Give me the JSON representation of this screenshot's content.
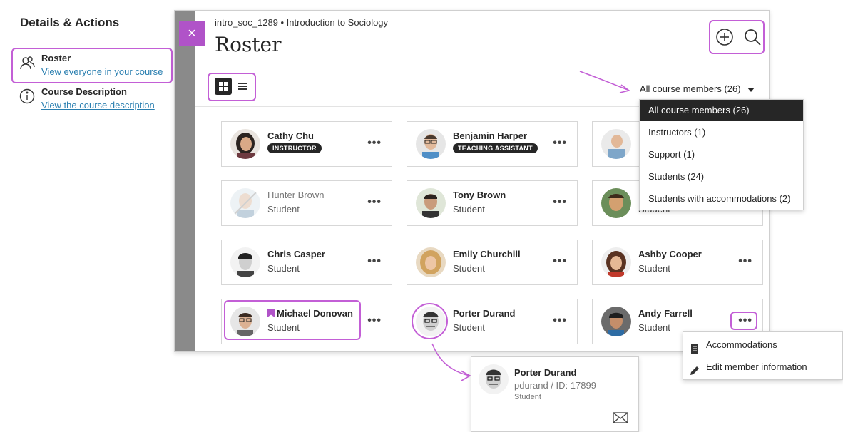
{
  "details_panel": {
    "title": "Details & Actions",
    "items": [
      {
        "name": "Roster",
        "link": "View everyone in your course",
        "icon": "roster-icon"
      },
      {
        "name": "Course Description",
        "link": "View the course description",
        "icon": "info-icon"
      }
    ]
  },
  "roster": {
    "course_breadcrumb": "intro_soc_1289 • Introduction to Sociology",
    "page_title": "Roster",
    "close_label": "×",
    "filter_label": "All course members (26)",
    "filter_options": [
      "All course members (26)",
      "Instructors (1)",
      "Support (1)",
      "Students (24)",
      "Students with accommodations (2)"
    ],
    "more_label": "•••",
    "members": [
      {
        "name": "Cathy Chu",
        "badge": "INSTRUCTOR",
        "role": ""
      },
      {
        "name": "Benjamin Harper",
        "badge": "TEACHING ASSISTANT",
        "role": ""
      },
      {
        "name": "",
        "badge": "",
        "role": ""
      },
      {
        "name": "Hunter Brown",
        "badge": "",
        "role": "Student"
      },
      {
        "name": "Tony Brown",
        "badge": "",
        "role": "Student"
      },
      {
        "name": "",
        "badge": "",
        "role": "Student"
      },
      {
        "name": "Chris Casper",
        "badge": "",
        "role": "Student"
      },
      {
        "name": "Emily Churchill",
        "badge": "",
        "role": "Student"
      },
      {
        "name": "Ashby Cooper",
        "badge": "",
        "role": "Student"
      },
      {
        "name": "Michael Donovan",
        "badge": "",
        "role": "Student"
      },
      {
        "name": "Porter Durand",
        "badge": "",
        "role": "Student"
      },
      {
        "name": "Andy Farrell",
        "badge": "",
        "role": "Student"
      }
    ]
  },
  "member_menu": {
    "items": [
      "Accommodations",
      "Edit member information"
    ]
  },
  "profile_card": {
    "name": "Porter Durand",
    "id_line": "pdurand / ID: 17899",
    "role": "Student"
  },
  "colors": {
    "highlight": "#c35fd6",
    "accent": "#b053c8",
    "link": "#2a7fb0",
    "dark": "#262626"
  }
}
